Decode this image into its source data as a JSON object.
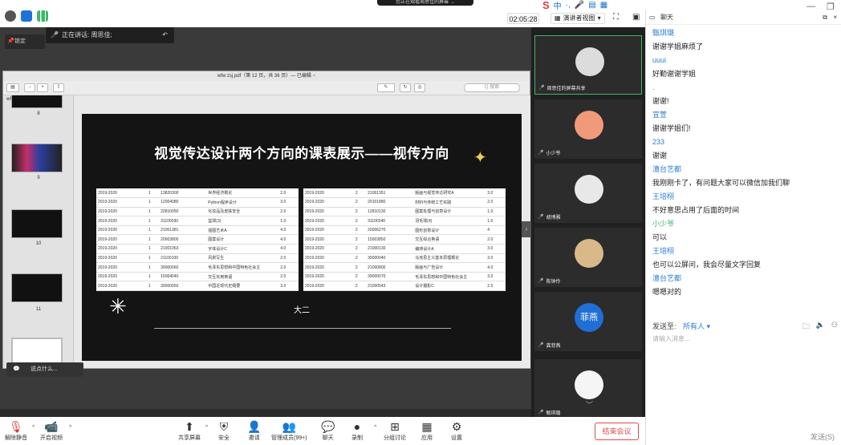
{
  "top": {
    "share_banner": "您正在观看周思佳的屏幕 →",
    "ime": [
      "中",
      "·,",
      "🎤",
      "▤",
      "▦"
    ],
    "timer": "02:05:28",
    "view_label": "演讲者视图",
    "chat_title": "聊天"
  },
  "presenter": {
    "lock_label": "锁定",
    "speaking_label": "正在讲话: 周思佳;",
    "say_something": "说点什么..."
  },
  "pdf": {
    "title": "wfw zsj.pdf（第 12 页，共 36 页）— 已编辑 ~",
    "search_placeholder": "Q 搜索",
    "sidebar_file": "wfw zsj.pdf",
    "thumb_numbers": [
      "8",
      "9",
      "10",
      "11"
    ]
  },
  "slide": {
    "title": "视觉传达设计两个方向的课表展示——视传方向",
    "grade": "大二",
    "left_table": [
      [
        "2019-2020",
        "1",
        "13820300",
        "世界经济概论",
        "2.0"
      ],
      [
        "2019-2020",
        "1",
        "12004080",
        "Python程序设计",
        "3.0"
      ],
      [
        "2019-2020",
        "1",
        "22810050",
        "化妆品及皮肤安全",
        "2.0"
      ],
      [
        "2019-2020",
        "1",
        "31100030",
        "篮球(3)",
        "1.0"
      ],
      [
        "2019-2020",
        "1",
        "21001381",
        "插图艺术A",
        "4.0"
      ],
      [
        "2019-2020",
        "1",
        "20003800",
        "图案设计",
        "4.0"
      ],
      [
        "2019-2020",
        "1",
        "21001063",
        "字体设计C",
        "4.0"
      ],
      [
        "2019-2020",
        "1",
        "21100100",
        "风景写生",
        "2.0"
      ],
      [
        "2019-2020",
        "1",
        "39000060",
        "毛泽东思想和中国特色社会主",
        "2.0"
      ],
      [
        "2019-2020",
        "1",
        "15004040",
        "交互实用英语",
        "2.0"
      ],
      [
        "2019-2020",
        "1",
        "39000050",
        "中国近现代史纲要",
        "3.0"
      ]
    ],
    "right_table": [
      [
        "2019-2020",
        "2",
        "21001351",
        "版画与视觉传达研究A",
        "3.0"
      ],
      [
        "2019-2020",
        "2",
        "20101880",
        "材料与传统工艺实践",
        "2.0"
      ],
      [
        "2019-2020",
        "2",
        "12810130",
        "图案处理与创意设计",
        "1.0"
      ],
      [
        "2019-2020",
        "2",
        "31100240",
        "羽毛球(4)",
        "1.0"
      ],
      [
        "2019-2020",
        "2",
        "20006270",
        "图形创意设计",
        "4"
      ],
      [
        "2019-2020",
        "2",
        "15003850",
        "交互综合英语",
        "2.0"
      ],
      [
        "2019-2020",
        "2",
        "21000130",
        "编排设计A",
        "3.0"
      ],
      [
        "2019-2020",
        "2",
        "39000040",
        "马克思主义基本原理概论",
        "3.0"
      ],
      [
        "2019-2020",
        "2",
        "21000800",
        "版画与广告设计",
        "4.0"
      ],
      [
        "2019-2020",
        "2",
        "39000070",
        "毛泽东思想和中国特色社会主",
        "3.0"
      ],
      [
        "2019-2020",
        "2",
        "21000543",
        "设计摄影C",
        "2.5"
      ]
    ]
  },
  "participants": [
    {
      "name": "周思佳的屏幕共享",
      "active": true,
      "avatar_color": "#dcdcdc"
    },
    {
      "name": "小少爷",
      "active": false,
      "avatar_color": "#f19a7a"
    },
    {
      "name": "胡博雅",
      "active": false,
      "avatar_color": "#e8e8e8"
    },
    {
      "name": "陈钟伶",
      "active": false,
      "avatar_color": "#d9b98a"
    },
    {
      "name": "龚菲燕",
      "active": false,
      "avatar_color": "#1f6fd6",
      "avatar_text": "菲燕"
    },
    {
      "name": "甄琪璐",
      "active": false,
      "avatar_color": "#f5f5f5"
    }
  ],
  "toolbar": {
    "mute": "解除静音",
    "video": "开启视频",
    "share": "共享屏幕",
    "security": "安全",
    "invite": "邀请",
    "members": "管理成员(99+)",
    "chat": "聊天",
    "record": "录制",
    "breakout": "分组讨论",
    "apps": "应用",
    "settings": "设置",
    "end": "结束会议"
  },
  "chat": {
    "messages": [
      {
        "name": "甄琪璐",
        "text": "谢谢学姐麻烦了"
      },
      {
        "name": "uuui",
        "text": "好勤谢谢学姐"
      },
      {
        "name": ".",
        "text": "谢谢!"
      },
      {
        "name": "宣萱",
        "text": "谢谢学姐们!"
      },
      {
        "name": "233",
        "text": "谢谢"
      },
      {
        "name": "澶台艺都",
        "text": "我刚刚卡了，有问题大家可以微信加我们聊"
      },
      {
        "name": "王培栩",
        "text": "不好意思占用了后面的时间"
      },
      {
        "name": "小少爷",
        "text": "可以",
        "green": true
      },
      {
        "name": "王培栩",
        "text": "也可以公屏问，我会尽量文字回复"
      },
      {
        "name": "澶台艺都",
        "text": "嗯嗯对的"
      }
    ],
    "send_to_label": "发送至:",
    "send_to_value": "所有人 ▾",
    "input_placeholder": "请输入消息...",
    "send_button": "发送(S)"
  }
}
